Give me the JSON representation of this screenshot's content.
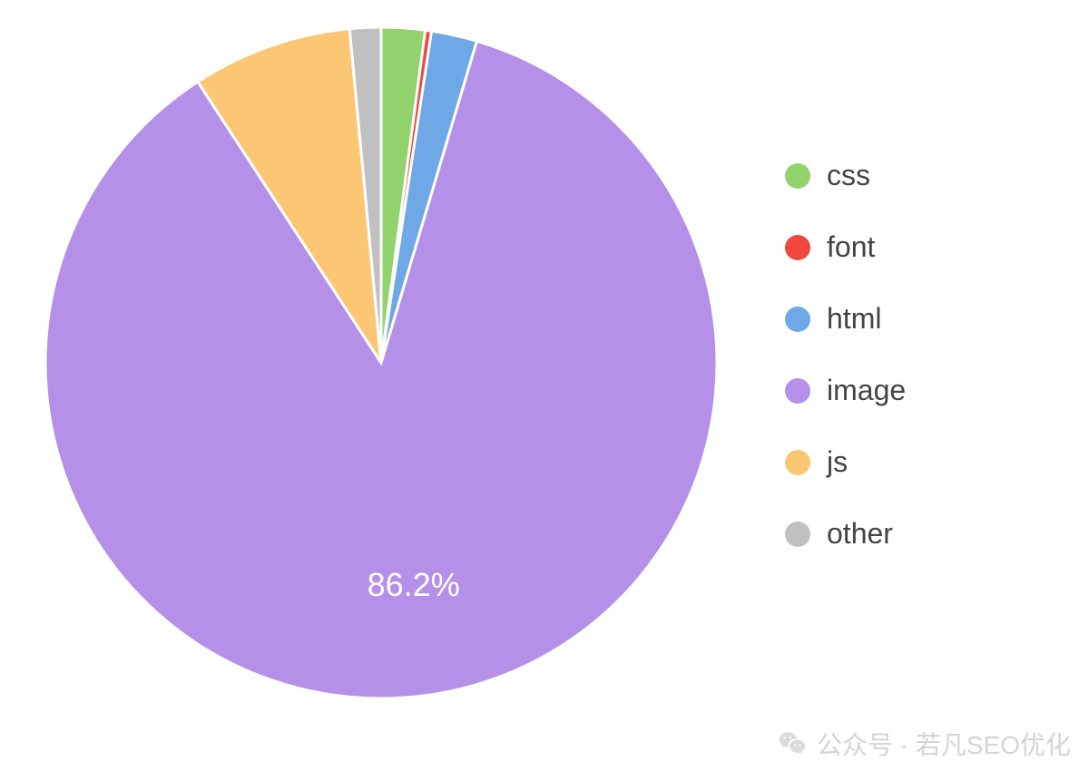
{
  "chart_data": {
    "type": "pie",
    "series": [
      {
        "name": "css",
        "value": 2.1,
        "color": "#92d36e"
      },
      {
        "name": "font",
        "value": 0.3,
        "color": "#f0483e"
      },
      {
        "name": "html",
        "value": 2.2,
        "color": "#6ea8e6"
      },
      {
        "name": "image",
        "value": 86.2,
        "color": "#b490e8",
        "label": "86.2%"
      },
      {
        "name": "js",
        "value": 7.7,
        "color": "#fcc774"
      },
      {
        "name": "other",
        "value": 1.5,
        "color": "#c0c0c0"
      }
    ],
    "legend_position": "right"
  },
  "legend": {
    "items": [
      {
        "label": "css",
        "color": "#92d36e"
      },
      {
        "label": "font",
        "color": "#f0483e"
      },
      {
        "label": "html",
        "color": "#6ea8e6"
      },
      {
        "label": "image",
        "color": "#b490e8"
      },
      {
        "label": "js",
        "color": "#fcc774"
      },
      {
        "label": "other",
        "color": "#c0c0c0"
      }
    ]
  },
  "watermark": {
    "text": "公众号 · 若凡SEO优化"
  }
}
